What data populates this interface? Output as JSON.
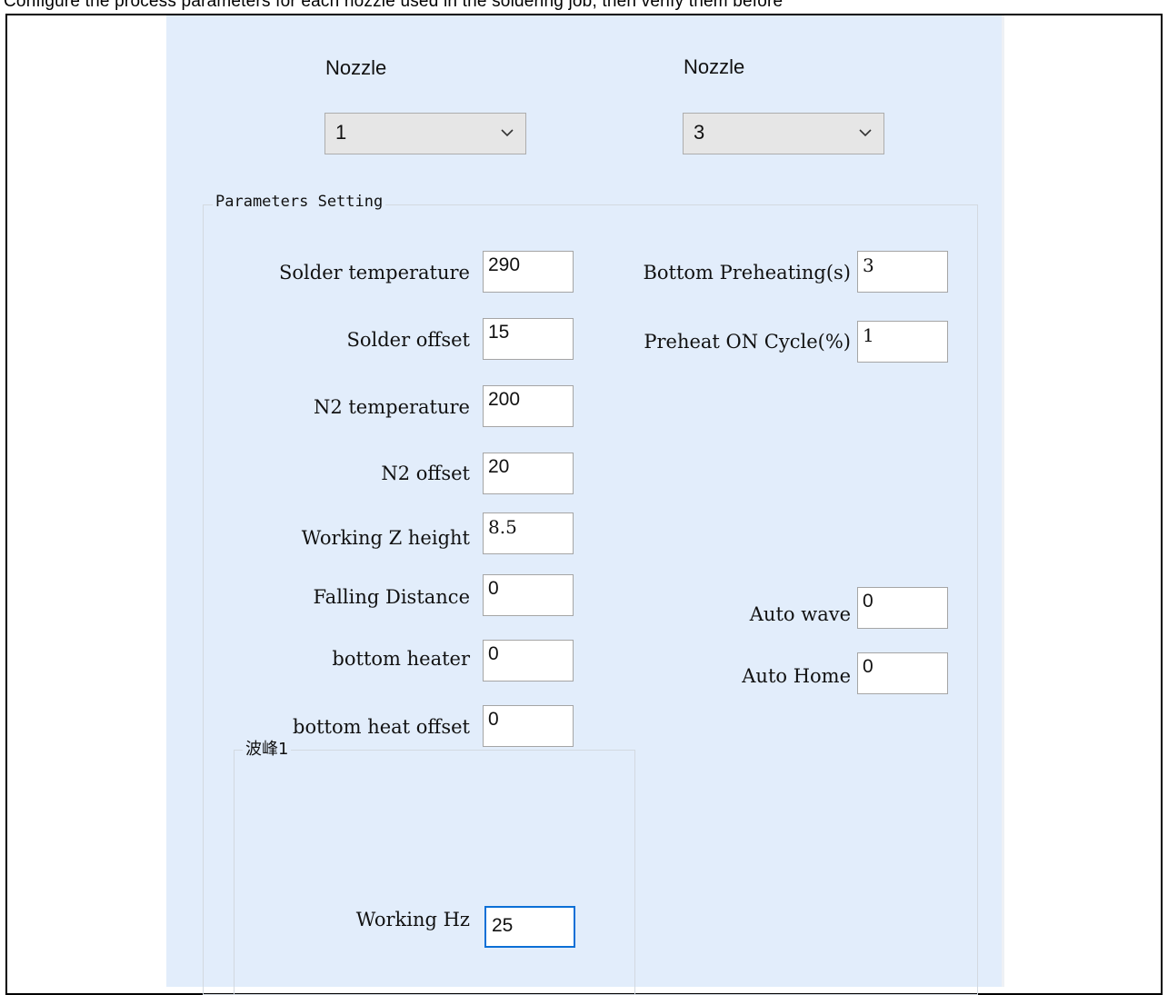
{
  "top_caption": "Configure the process parameters for each nozzle used in the soldering job, then verify them before",
  "nozzle_left": {
    "label": "Nozzle",
    "selected": "1"
  },
  "nozzle_right": {
    "label": "Nozzle",
    "selected": "3"
  },
  "parameters": {
    "title": "Parameters Setting",
    "left_fields": [
      {
        "label": "Solder temperature",
        "value": "290"
      },
      {
        "label": "Solder offset",
        "value": "15"
      },
      {
        "label": "N2 temperature",
        "value": "200"
      },
      {
        "label": "N2 offset",
        "value": "20"
      },
      {
        "label": "Working Z height",
        "value": "8.5"
      },
      {
        "label": "Falling Distance",
        "value": "0"
      },
      {
        "label": "bottom heater",
        "value": "0"
      },
      {
        "label": "bottom heat offset",
        "value": "0"
      }
    ],
    "right_fields": [
      {
        "label": "Bottom Preheating(s)",
        "value": "3"
      },
      {
        "label": "Preheat ON Cycle(%)",
        "value": "1"
      },
      {
        "label": "Auto wave",
        "value": "0"
      },
      {
        "label": "Auto Home",
        "value": "0"
      }
    ]
  },
  "wave": {
    "title": "波峰1",
    "field": {
      "label": "Working Hz",
      "value": "25"
    }
  },
  "icons": {
    "combo_arrow": "chevron-down-icon"
  },
  "colors": {
    "panel_background": "#e2edfb",
    "focus_border": "#0b6fd6"
  }
}
